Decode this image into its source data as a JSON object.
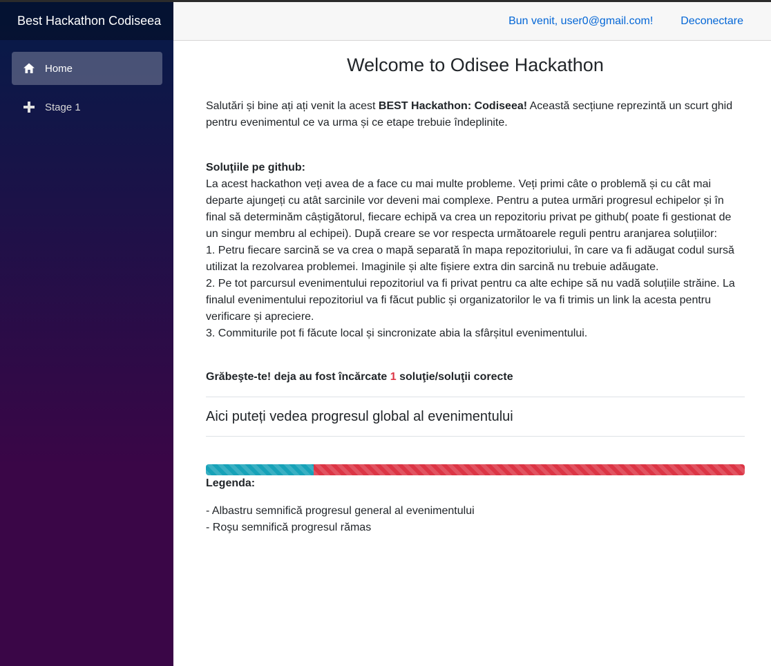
{
  "sidebar": {
    "brand": "Best Hackathon Codiseea",
    "items": [
      {
        "label": "Home",
        "icon": "home-icon",
        "active": true
      },
      {
        "label": "Stage 1",
        "icon": "plus-icon",
        "active": false
      }
    ]
  },
  "header": {
    "welcome": "Bun venit, user0@gmail.com!",
    "logout": "Deconectare"
  },
  "main": {
    "title": "Welcome to Odisee Hackathon",
    "intro_pre": "Salutări și bine ați ați venit la acest ",
    "intro_bold": "BEST Hackathon: Codiseea!",
    "intro_post": " Această secțiune reprezintă un scurt ghid pentru evenimentul ce va urma și ce etape trebuie îndeplinite.",
    "github_heading": "Soluţiile pe github:",
    "github_text": "La acest hackathon veți avea de a face cu mai multe probleme. Veți primi câte o problemă și cu cât mai departe ajungeți cu atât sarcinile vor deveni mai complexe. Pentru a putea urmări progresul echipelor și în final să determinăm câștigătorul, fiecare echipă va crea un repozitoriu privat pe github( poate fi gestionat de un singur membru al echipei). După creare se vor respecta următoarele reguli pentru aranjarea soluțiilor:",
    "rules": [
      "1. Petru fiecare sarcină se va crea o mapă separată în mapa repozitoriului, în care va fi adăugat codul sursă utilizat la rezolvarea problemei. Imaginile și alte fișiere extra din sarcină nu trebuie adăugate.",
      "2. Pe tot parcursul evenimentului repozitoriul va fi privat pentru ca alte echipe să nu vadă soluțiile străine. La finalul evenimentului repozitoriul va fi făcut public și organizatorilor le va fi trimis un link la acesta pentru verificare și apreciere.",
      "3. Commiturile pot fi făcute local și sincronizate abia la sfârșitul evenimentului."
    ],
    "hurry_pre": "Grăbeşte-te! deja au fost încărcate ",
    "hurry_count": "1",
    "hurry_post": " soluţie/soluţii corecte",
    "progress_title": "Aici puteți vedea progresul global al evenimentului",
    "progress": {
      "completed_fraction": 0.2,
      "remaining_fraction": 0.8
    },
    "legend_title": "Legenda:",
    "legend": [
      "- Albastru semnifică progresul general al evenimentului",
      "- Roşu semnifică progresul rămas"
    ]
  },
  "colors": {
    "sidebar_top": "#051b48",
    "sidebar_bottom": "#3a0647",
    "link": "#0366d6",
    "progress_done": "#17a2b8",
    "progress_remaining": "#dc3545"
  }
}
